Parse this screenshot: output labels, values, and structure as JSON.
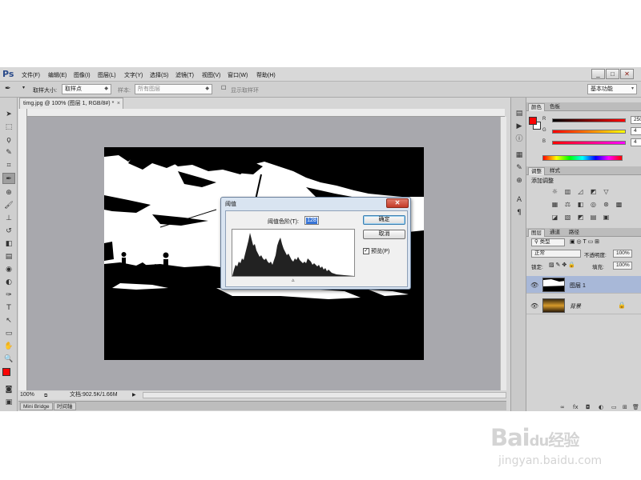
{
  "app": {
    "logo": "Ps",
    "menu": [
      "文件(F)",
      "编辑(E)",
      "图像(I)",
      "图层(L)",
      "文字(Y)",
      "选择(S)",
      "滤镜(T)",
      "视图(V)",
      "窗口(W)",
      "帮助(H)"
    ],
    "window_buttons": [
      "_",
      "□",
      "✕"
    ]
  },
  "options_bar": {
    "sample_size_label": "取样大小:",
    "sample_size_value": "取样点",
    "sample_label": "样本:",
    "sample_value": "所有图层",
    "show_ring_label": "显示取样环",
    "workspace": "基本功能"
  },
  "document": {
    "tab_title": "timg.jpg @ 100% (图层 1, RGB/8#) *",
    "zoom": "100%",
    "doc_info": "文档:902.5K/1.66M",
    "bottom_tabs": [
      "Mini Bridge",
      "时间轴"
    ]
  },
  "dialog": {
    "title": "阈值",
    "close": "✕",
    "level_label": "阈值色阶(T):",
    "level_value": "128",
    "ok": "确定",
    "cancel": "取消",
    "preview_label": "预览(P)",
    "preview_checked": true
  },
  "color_panel": {
    "tabs": [
      "颜色",
      "色板"
    ],
    "sliders": [
      {
        "label": "R",
        "value": "250"
      },
      {
        "label": "G",
        "value": "4"
      },
      {
        "label": "B",
        "value": "4"
      }
    ],
    "foreground": "#fa0404"
  },
  "adjust_panel": {
    "tabs": [
      "调整",
      "样式"
    ],
    "add_label": "添加调整"
  },
  "layers_panel": {
    "tabs": [
      "图层",
      "通道",
      "路径"
    ],
    "kind_filter": "类型",
    "blend_mode": "正常",
    "opacity_label": "不透明度:",
    "opacity_value": "100%",
    "lock_label": "锁定:",
    "fill_label": "填充:",
    "fill_value": "100%",
    "layers": [
      {
        "name": "图层 1",
        "selected": true
      },
      {
        "name": "背景",
        "selected": false
      }
    ],
    "bottom_icons": [
      "∞",
      "fx",
      "◘",
      "◐",
      "▭",
      "⊞",
      "🗑"
    ]
  },
  "watermark": {
    "brand": "Bai",
    "brand2": "经验",
    "url": "jingyan.baidu.com"
  }
}
